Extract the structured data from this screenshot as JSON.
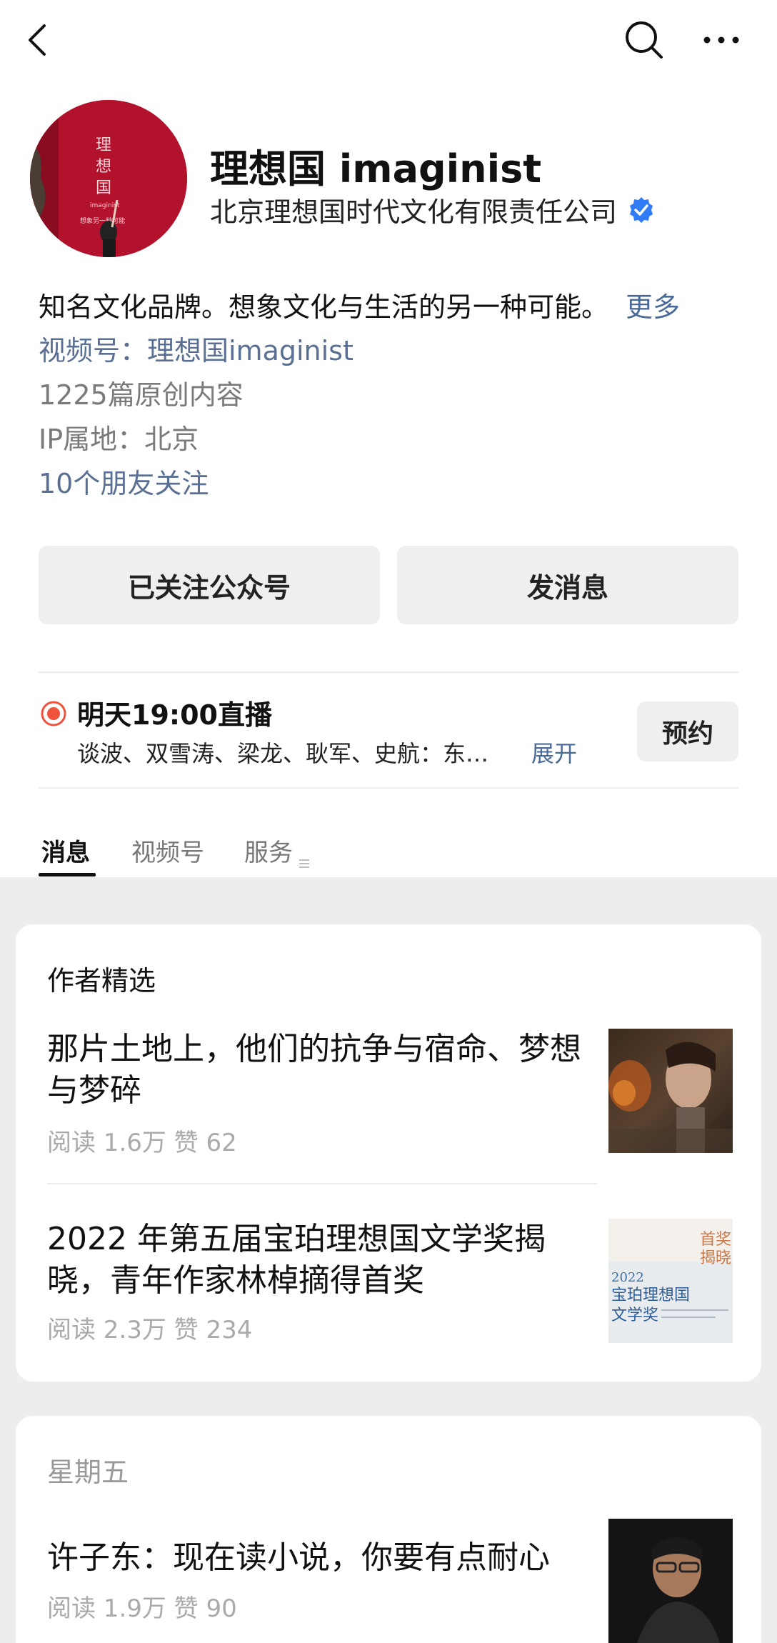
{
  "profile": {
    "name": "理想国 imaginist",
    "company": "北京理想国时代文化有限责任公司",
    "avatar_text": [
      "理",
      "想",
      "国",
      "imaginist",
      "想象另一种可能"
    ],
    "description": "知名文化品牌。想象文化与生活的另一种可能。",
    "more_link": "更多",
    "channel": "视频号：理想国imaginist",
    "original_count": "1225篇原创内容",
    "ip_location": "IP属地：北京",
    "friends_following": "10个朋友关注"
  },
  "actions": {
    "follow_label": "已关注公众号",
    "message_label": "发消息"
  },
  "live": {
    "title": "明天19:00直播",
    "subtitle": "谈波、双雪涛、梁龙、耿军、史航：东…",
    "expand": "展开",
    "reserve": "预约"
  },
  "tabs": [
    {
      "label": "消息",
      "active": true
    },
    {
      "label": "视频号",
      "active": false
    },
    {
      "label": "服务",
      "active": false
    }
  ],
  "feed": {
    "card1": {
      "header": "作者精选",
      "articles": [
        {
          "title": "那片土地上，他们的抗争与宿命、梦想与梦碎",
          "meta": "阅读 1.6万  赞 62"
        },
        {
          "title": "2022 年第五届宝珀理想国文学奖揭晓，青年作家林棹摘得首奖",
          "meta": "阅读 2.3万  赞 234",
          "thumb_text": [
            "首奖",
            "揭晓",
            "2022",
            "宝珀理想国",
            "文学奖"
          ]
        }
      ]
    },
    "card2": {
      "header": "星期五",
      "articles": [
        {
          "title": "许子东：现在读小说，你要有点耐心",
          "meta": "阅读 1.9万  赞 90"
        }
      ]
    }
  },
  "colors": {
    "accent_blue": "#5a6f94",
    "live_red": "#f0533c",
    "verified_blue": "#2f7cf6"
  }
}
